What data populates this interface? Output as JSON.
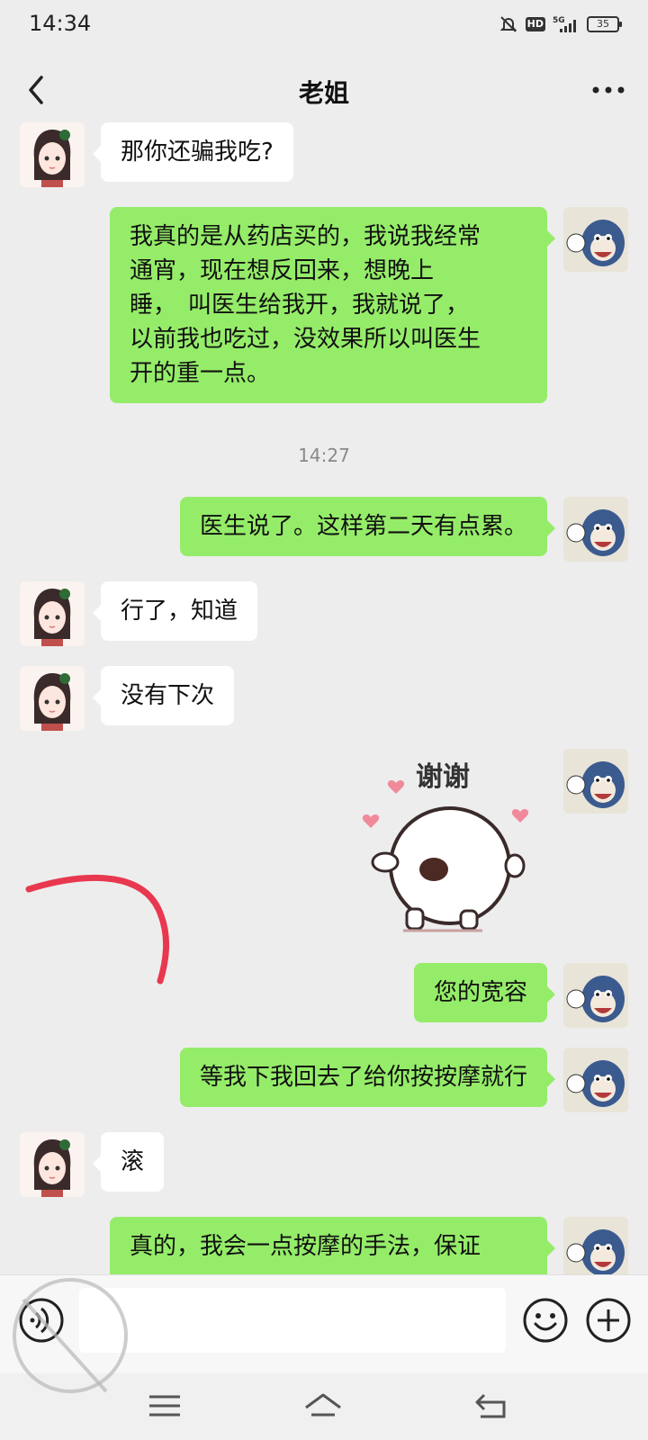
{
  "status_bar": {
    "time": "14:34",
    "battery": "35"
  },
  "header": {
    "title": "老姐"
  },
  "messages": [
    {
      "text": "那你还骗我吃?"
    },
    {
      "lines": [
        "我真的是从药店买的，我说我经常",
        "通宵，现在想反回来，想晚上",
        "睡，　叫医生给我开，我就说了，",
        "以前我也吃过，没效果所以叫医生",
        "开的重一点。"
      ]
    },
    {
      "text": "医生说了。这样第二天有点累。"
    },
    {
      "text": "行了，知道"
    },
    {
      "text": "没有下次"
    },
    {
      "text": "您的宽容"
    },
    {
      "text": "等我下我回去了给你按按摩就行"
    },
    {
      "text": "滚"
    },
    {
      "text": "真的，我会一点按摩的手法，保证"
    }
  ],
  "timestamp": "14:27",
  "sticker": {
    "caption": "谢谢"
  },
  "colors": {
    "bg": "#ededed",
    "bubble_sent": "#95ec69",
    "bubble_received": "#ffffff",
    "annotation_red": "#e8384f"
  },
  "icons": {
    "back": "chevron-left-icon",
    "more": "more-dots-icon",
    "voice": "voice-icon",
    "emoji": "emoji-icon",
    "plus": "plus-icon"
  }
}
